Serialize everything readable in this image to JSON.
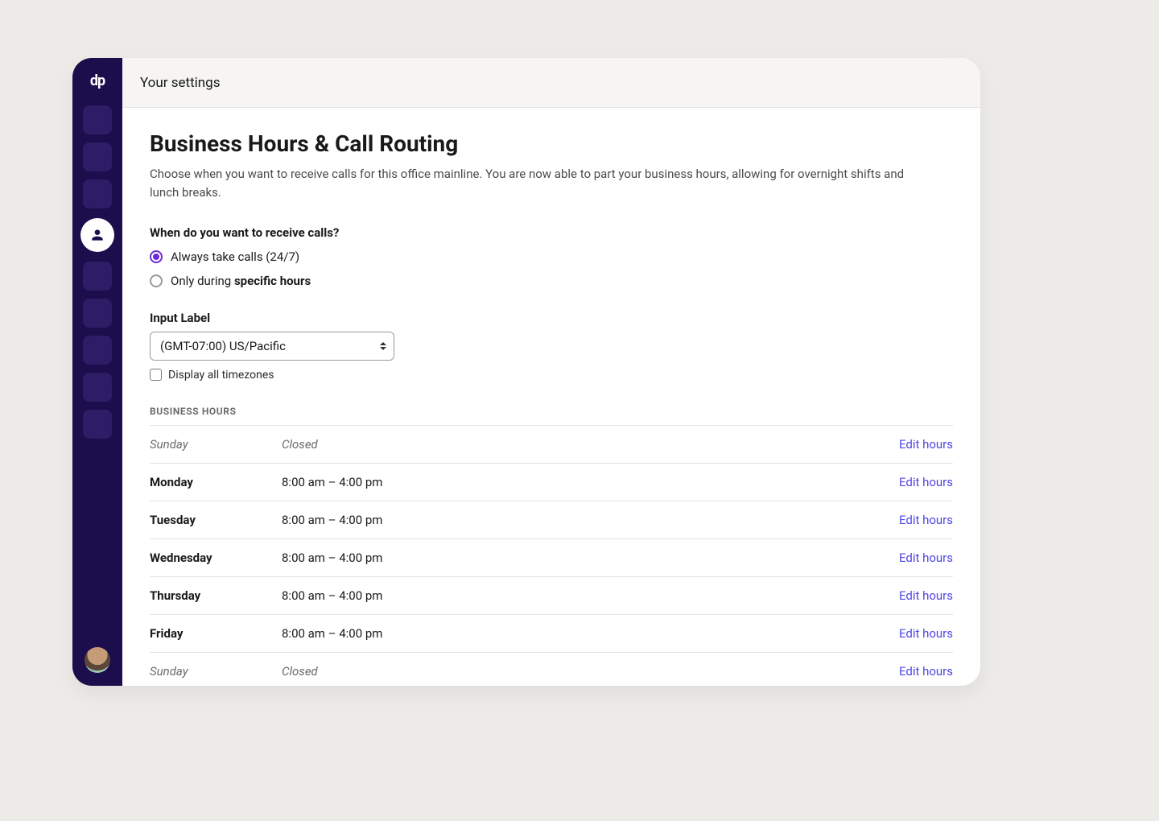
{
  "topbar": {
    "title": "Your settings"
  },
  "page": {
    "heading": "Business Hours & Call Routing",
    "description": "Choose when you want to receive calls for this office mainline. You are now able to part your business hours, allowing for overnight shifts and lunch breaks."
  },
  "receive_calls": {
    "question": "When do you want to receive calls?",
    "options": [
      {
        "label_plain": "Always take calls (24/7)",
        "label_bold": "",
        "selected": true
      },
      {
        "label_plain": "Only during ",
        "label_bold": "specific hours",
        "selected": false
      }
    ]
  },
  "timezone": {
    "input_label": "Input Label",
    "selected": "(GMT-07:00) US/Pacific",
    "display_all_label": "Display all timezones",
    "display_all_checked": false
  },
  "business_hours": {
    "header": "BUSINESS HOURS",
    "edit_label": "Edit hours",
    "rows": [
      {
        "day": "Sunday",
        "hours": "Closed",
        "closed": true
      },
      {
        "day": "Monday",
        "hours": "8:00 am – 4:00 pm",
        "closed": false
      },
      {
        "day": "Tuesday",
        "hours": "8:00 am – 4:00 pm",
        "closed": false
      },
      {
        "day": "Wednesday",
        "hours": "8:00 am – 4:00 pm",
        "closed": false
      },
      {
        "day": "Thursday",
        "hours": "8:00 am – 4:00 pm",
        "closed": false
      },
      {
        "day": "Friday",
        "hours": "8:00 am – 4:00 pm",
        "closed": false
      },
      {
        "day": "Sunday",
        "hours": "Closed",
        "closed": true
      }
    ]
  },
  "sidebar": {
    "logo": "dp"
  }
}
